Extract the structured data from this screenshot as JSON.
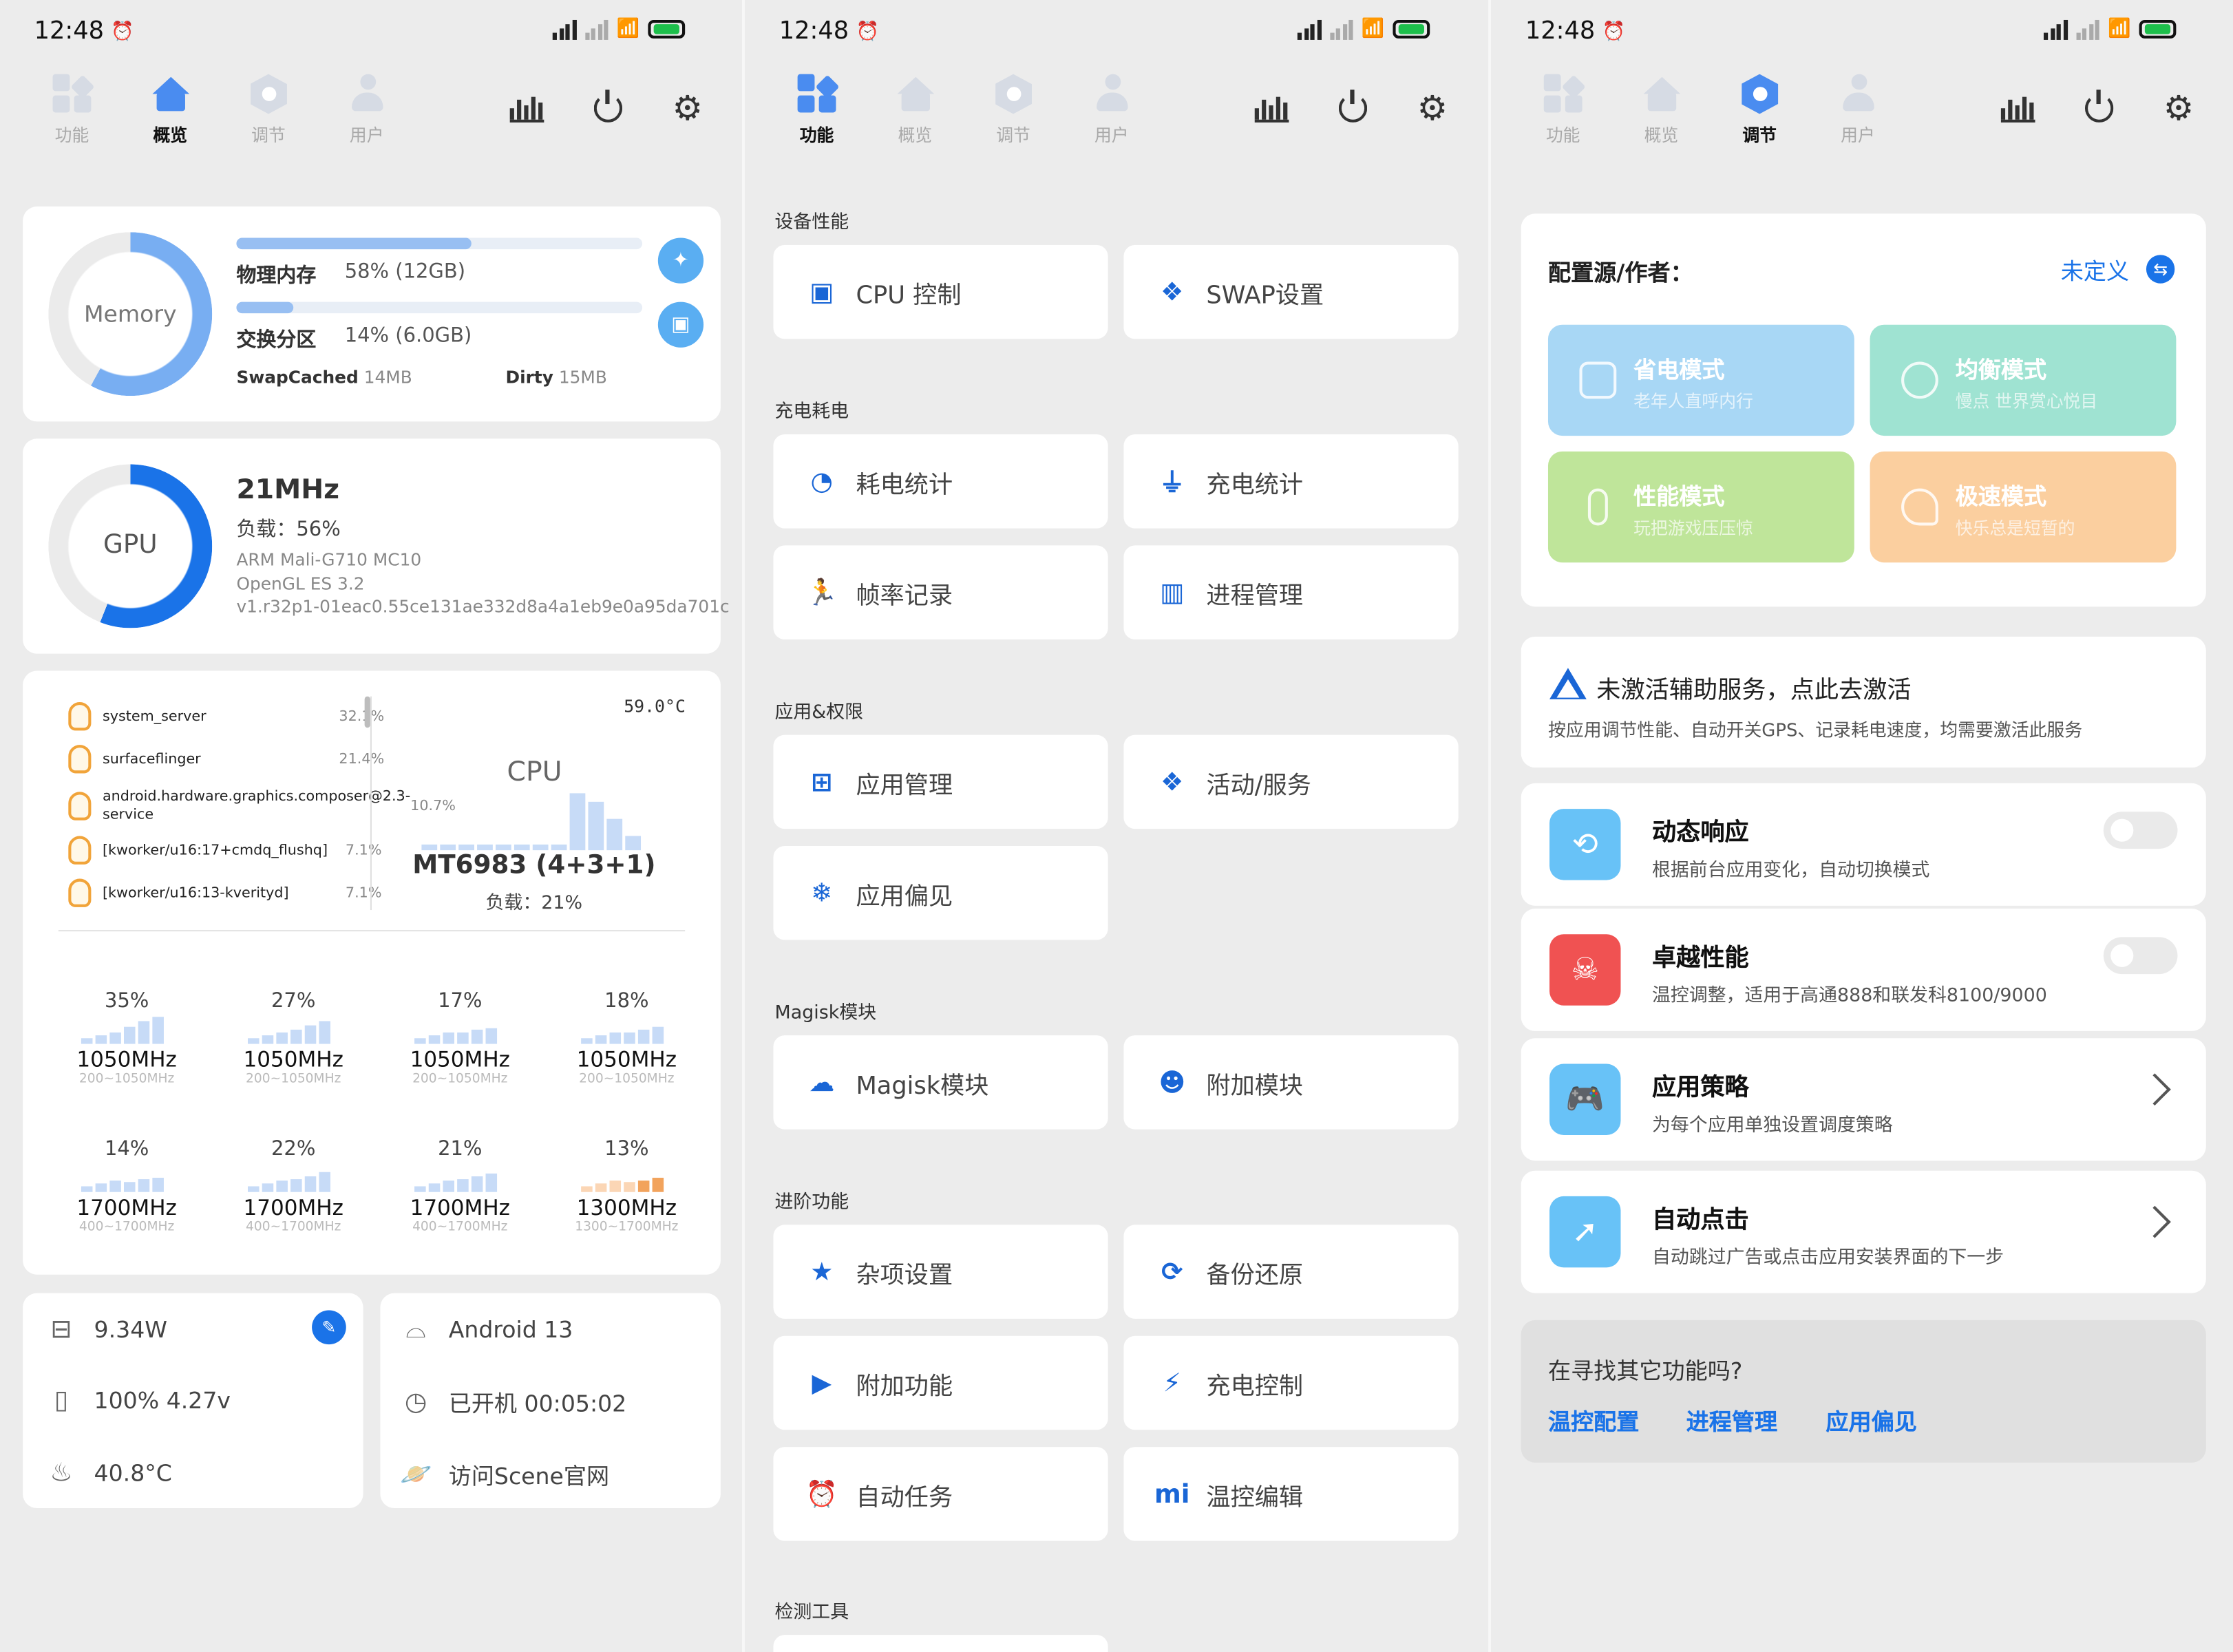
{
  "status": {
    "time": "12:48"
  },
  "tabs": [
    "功能",
    "概览",
    "调节",
    "用户"
  ],
  "overview": {
    "memory": {
      "ring_label": "Memory",
      "phys_label": "物理内存",
      "phys_value": "58% (12GB)",
      "phys_pct": 0.58,
      "swap_label": "交换分区",
      "swap_value": "14% (6.0GB)",
      "swap_pct": 0.14,
      "swapcached_label": "SwapCached",
      "swapcached_value": "14MB",
      "dirty_label": "Dirty",
      "dirty_value": "15MB"
    },
    "gpu": {
      "ring_label": "GPU",
      "freq": "21MHz",
      "load": "负载：56%",
      "load_pct": 0.56,
      "model": "ARM Mali-G710 MC10",
      "opengl": "OpenGL ES 3.2",
      "driver": "v1.r32p1-01eac0.55ce131ae332d8a4a1eb9e0a95da701c"
    },
    "processes": [
      {
        "name": "system_server",
        "value": "32.1%"
      },
      {
        "name": "surfaceflinger",
        "value": "21.4%"
      },
      {
        "name": "android.hardware.graphics.composer@2.3-service",
        "value": "10.7%"
      },
      {
        "name": "[kworker/u16:17+cmdq_flushq]",
        "value": "7.1%"
      },
      {
        "name": "[kworker/u16:13-kverityd]",
        "value": "7.1%"
      }
    ],
    "cpu": {
      "temp": "59.0°C",
      "label": "CPU",
      "model": "MT6983 (4+3+1)",
      "load": "负载：21%"
    },
    "cores": [
      {
        "pct": "35%",
        "mhz": "1050MHz",
        "range": "200~1050MHz",
        "color": "#9cc3f5"
      },
      {
        "pct": "27%",
        "mhz": "1050MHz",
        "range": "200~1050MHz",
        "color": "#9cc3f5"
      },
      {
        "pct": "17%",
        "mhz": "1050MHz",
        "range": "200~1050MHz",
        "color": "#9cc3f5"
      },
      {
        "pct": "18%",
        "mhz": "1050MHz",
        "range": "200~1050MHz",
        "color": "#9cc3f5"
      },
      {
        "pct": "14%",
        "mhz": "1700MHz",
        "range": "400~1700MHz",
        "color": "#9cc3f5"
      },
      {
        "pct": "22%",
        "mhz": "1700MHz",
        "range": "400~1700MHz",
        "color": "#9cc3f5"
      },
      {
        "pct": "21%",
        "mhz": "1700MHz",
        "range": "400~1700MHz",
        "color": "#9cc3f5"
      },
      {
        "pct": "13%",
        "mhz": "1300MHz",
        "range": "1300~1700MHz",
        "color": "#f2a35c"
      }
    ],
    "battery": {
      "power": "9.34W",
      "level": "100%  4.27v",
      "temp": "40.8°C"
    },
    "system": {
      "android": "Android 13",
      "uptime": "已开机  00:05:02",
      "site": "访问Scene官网"
    }
  },
  "functions": {
    "sections": [
      {
        "title": "设备性能",
        "items": [
          "CPU 控制",
          "SWAP设置"
        ]
      },
      {
        "title": "充电耗电",
        "items": [
          "耗电统计",
          "充电统计",
          "帧率记录",
          "进程管理"
        ]
      },
      {
        "title": "应用&权限",
        "items": [
          "应用管理",
          "活动/服务",
          "应用偏见"
        ]
      },
      {
        "title": "Magisk模块",
        "items": [
          "Magisk模块",
          "附加模块"
        ]
      },
      {
        "title": "进阶功能",
        "items": [
          "杂项设置",
          "备份还原",
          "附加功能",
          "充电控制",
          "自动任务",
          "温控编辑"
        ]
      },
      {
        "title": "检测工具",
        "items": []
      }
    ]
  },
  "tune": {
    "config_label": "配置源/作者：",
    "config_value": "未定义",
    "modes": [
      {
        "title": "省电模式",
        "sub": "老年人直呼内行",
        "color": "#a8d7f5"
      },
      {
        "title": "均衡模式",
        "sub": "慢点 世界赏心悦目",
        "color": "#9fe3d2"
      },
      {
        "title": "性能模式",
        "sub": "玩把游戏压压惊",
        "color": "#bfe59a"
      },
      {
        "title": "极速模式",
        "sub": "快乐总是短暂的",
        "color": "#fbcf9f"
      }
    ],
    "warning_title": "未激活辅助服务，点此去激活",
    "warning_sub": "按应用调节性能、自动开关GPS、记录耗电速度，均需要激活此服务",
    "features": [
      {
        "title": "动态响应",
        "sub": "根据前台应用变化，自动切换模式",
        "color": "#68c2f7"
      },
      {
        "title": "卓越性能",
        "sub": "温控调整，适用于高通888和联发科8100/9000",
        "color": "#f05252"
      },
      {
        "title": "应用策略",
        "sub": "为每个应用单独设置调度策略",
        "color": "#68c2f7"
      },
      {
        "title": "自动点击",
        "sub": "自动跳过广告或点击应用安装界面的下一步",
        "color": "#68c2f7"
      }
    ],
    "more_title": "在寻找其它功能吗?",
    "more_links": [
      "温控配置",
      "进程管理",
      "应用偏见"
    ]
  }
}
